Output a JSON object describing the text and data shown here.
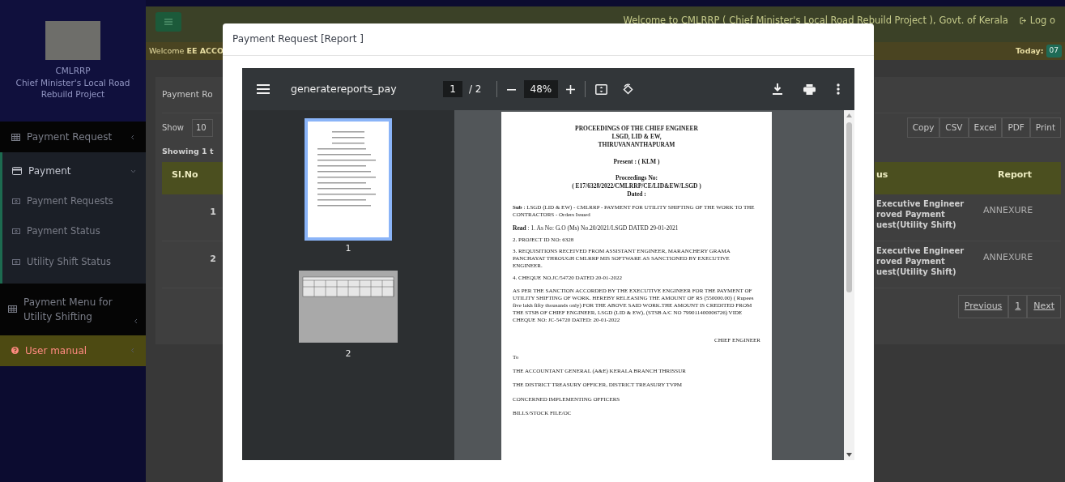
{
  "sidebar": {
    "brand_lines": [
      "CMLRRP",
      "Chief Minister's Local Road Rebuild Project"
    ],
    "menu": [
      {
        "kind": "menu",
        "label": "Payment Request",
        "expanded": false
      },
      {
        "kind": "group",
        "label": "Payment",
        "expanded": true,
        "children": [
          {
            "label": "Payment Requests"
          },
          {
            "label": "Payment Status"
          },
          {
            "label": "Utility Shift Status"
          }
        ]
      },
      {
        "kind": "menu",
        "label": "Payment Menu for Utility Shifting",
        "expanded": false
      },
      {
        "kind": "manual",
        "label": "User manual",
        "expanded": false
      }
    ]
  },
  "topbar": {
    "marquee": "Welcome to CMLRRP ( Chief Minister's Local Road Rebuild Project ), Govt. of Kerala",
    "logout": "Log o"
  },
  "welcome_bar": {
    "greeting": "Welcome **EE ACCO**",
    "today_label": "Today:",
    "date": "07"
  },
  "content": {
    "card_title": "Payment Ro",
    "show_label": "Show",
    "page_size": "10",
    "info": "Showing 1 t",
    "export_buttons": [
      "Copy",
      "CSV",
      "Excel",
      "PDF",
      "Print"
    ],
    "columns": [
      "Sl.No",
      "us",
      "Report"
    ],
    "rows": [
      {
        "sl_no": "1",
        "status_lines": [
          "Executive Engineer",
          "roved Payment",
          "uest(Utility Shift)"
        ],
        "report": "ANNEXURE"
      },
      {
        "sl_no": "2",
        "status_lines": [
          "Executive Engineer",
          "roved Payment",
          "uest(Utility Shift)"
        ],
        "report": "ANNEXURE"
      }
    ],
    "pagination": [
      "Previous",
      "1",
      "Next"
    ]
  },
  "modal": {
    "title": "Payment Request [Report ]",
    "viewer": {
      "filename": "generatereports_pay",
      "page": "1",
      "page_count": "/ 2",
      "zoom": "48%",
      "thumbnails": [
        {
          "label": "1",
          "kind": "portrait",
          "selected": true
        },
        {
          "label": "2",
          "kind": "landscape",
          "selected": false
        }
      ],
      "document": {
        "heading_lines": [
          "PROCEEDINGS OF THE CHIEF ENGINEER",
          "LSGD, LID & EW,",
          "THIRUVANANTHAPURAM"
        ],
        "present": "Present : ( KLM )",
        "proceedings_lines": [
          "Proceedings No:",
          "( E17/6328/2022/CMLRRP/CE/LID&EW/LSGD )",
          "Dated :"
        ],
        "subject": "**Sub** : LSGD (LID & EW) - CMLRRP - PAYMENT FOR UTILITY SHIFTING OF THE WORK TO THE CONTRACTORS - Orders Issued",
        "read": "**Read** : 1. As No: G.O (Ms) No.20/2021/LSGD DATED 29-01-2021",
        "references": [
          "2. PROJECT ID NO: 6328",
          "3. REQUISITIONS RECEIVED FROM ASSISTANT ENGINEER, MARANCHERY GRAMA PANCHAYAT THROUGH CMLRRP MIS SOFTWARE AS SANCTIONED BY EXECUTIVE ENGINEER.",
          "4. CHEQUE NO.JC/54720 DATED 20-01-2022"
        ],
        "body": "AS PER THE SANCTION ACCORDED BY THE EXECUTIVE ENGINEER FOR THE PAYMENT OF UTILITY SHIFTING OF WORK. HEREBY RELEASING THE AMOUNT OF RS (550000.00) ( Rupees five lakh fifty thousands only) FOR THE ABOVE SAID WORK.THE AMOUNT IS CREDITED FROM THE STSB OF CHIEF ENGINEER, LSGD (LID & EW), (STSB A/C NO 799011400006726) VIDE CHEQUE NO: JC-54720 DATED: 20-01-2022",
        "signature": "CHIEF ENGINEER",
        "to": "To",
        "recipients": [
          "THE ACCOUNTANT GENERAL (A&E) KERALA BRANCH THRISSUR",
          "THE DISTRICT TREASURY OFFICER, DISTRICT TREASURY TVPM",
          "CONCERNED IMPLEMENTING OFFICERS",
          "BILLS/STOCK FILE/OC"
        ]
      }
    }
  }
}
